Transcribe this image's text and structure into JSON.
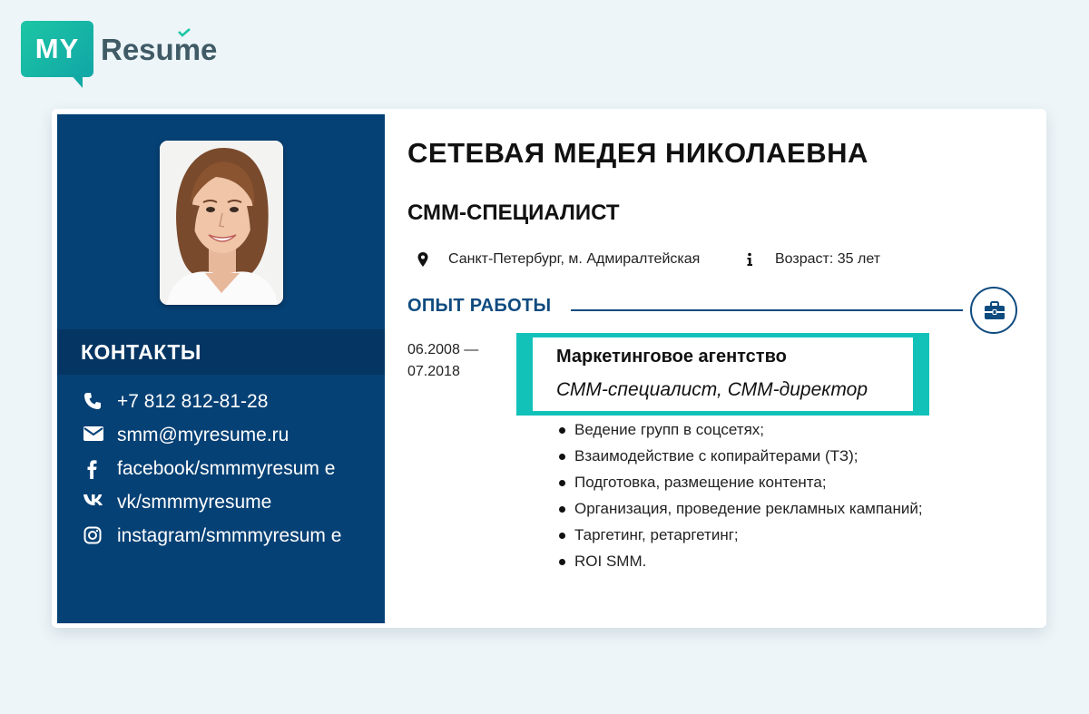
{
  "logo": {
    "badge_text": "MY",
    "word_text": "Resume"
  },
  "resume": {
    "full_name": "СЕТЕВАЯ МЕДЕЯ НИКОЛАЕВНА",
    "position": "СММ-СПЕЦИАЛИСТ",
    "location": "Санкт-Петербург, м. Адмиралтейская",
    "age": "Возраст: 35 лет",
    "experience_title": "ОПЫТ РАБОТЫ",
    "job": {
      "dates_start": "06.2008 —",
      "dates_end": "07.2018",
      "company": "Маркетинговое агентство",
      "role": "СММ-специалист, СММ-директор",
      "duties": [
        "Ведение групп в соцсетях;",
        "Взаимодействие с копирайтерами (ТЗ);",
        "Подготовка, размещение контента;",
        "Организация, проведение рекламных кампаний;",
        "Таргетинг, ретаргетинг;",
        "ROI SMM."
      ]
    }
  },
  "contacts": {
    "title": "КОНТАКТЫ",
    "items": [
      {
        "icon": "phone-icon",
        "text": "+7 812 812-81-28"
      },
      {
        "icon": "envelope-icon",
        "text": "smm@myresume.ru"
      },
      {
        "icon": "facebook-icon",
        "text": "facebook/smmmyresum e"
      },
      {
        "icon": "vk-icon",
        "text": "vk/smmmyresume"
      },
      {
        "icon": "instagram-icon",
        "text": "instagram/smmmyresum e"
      }
    ]
  },
  "colors": {
    "sidebar": "#064175",
    "sidebar_header": "#053562",
    "accent_teal": "#12c2b9",
    "heading_blue": "#0e4b7f",
    "page_background": "#edf5f8"
  }
}
